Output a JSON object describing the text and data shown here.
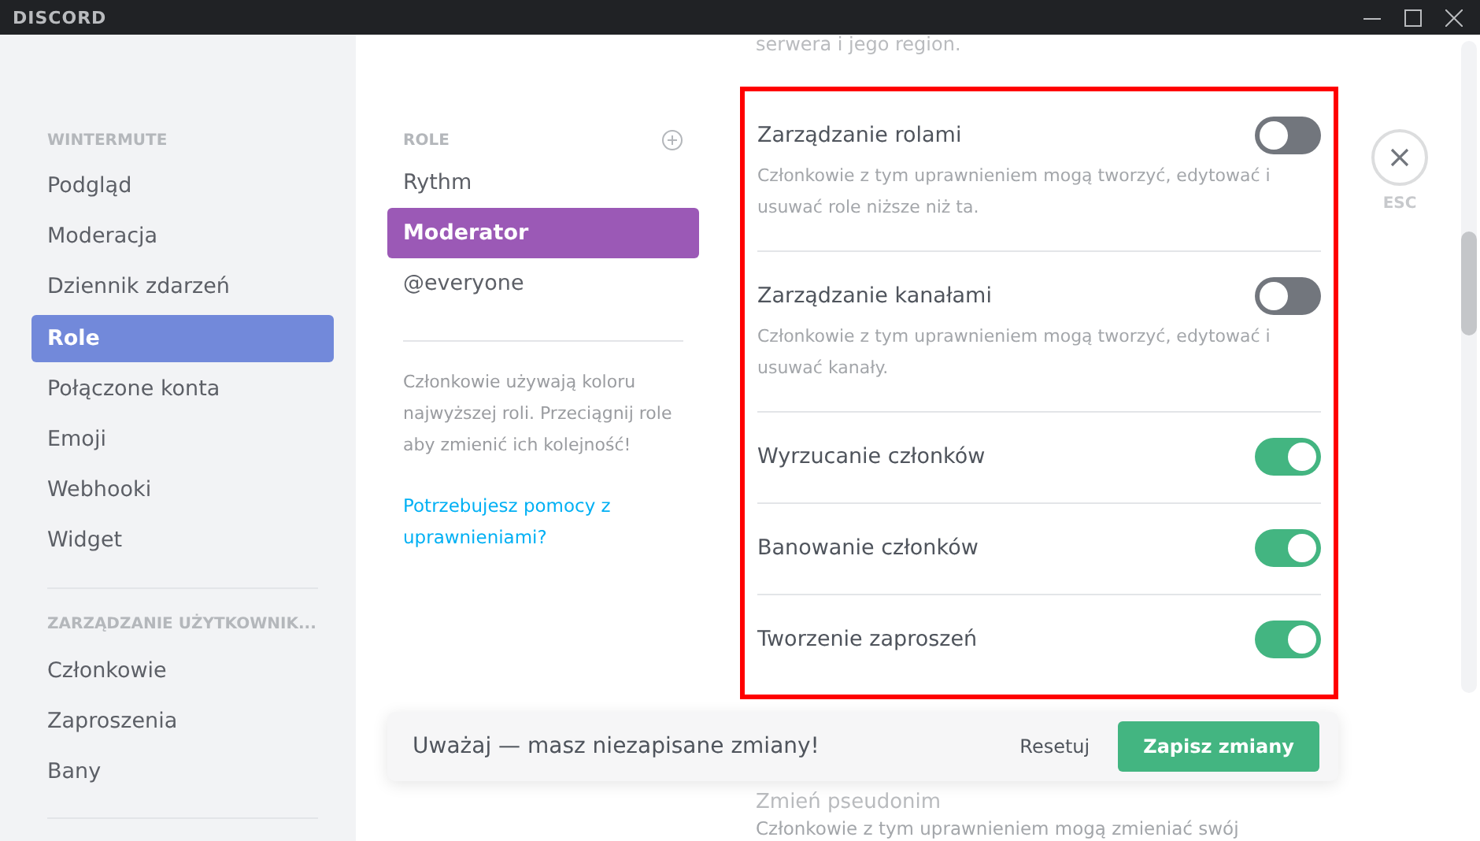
{
  "window": {
    "title": "DISCORD"
  },
  "sidebar": {
    "sections": [
      {
        "header": "WINTERMUTE",
        "items": [
          {
            "label": "Podgląd",
            "selected": false
          },
          {
            "label": "Moderacja",
            "selected": false
          },
          {
            "label": "Dziennik zdarzeń",
            "selected": false
          },
          {
            "label": "Role",
            "selected": true
          },
          {
            "label": "Połączone konta",
            "selected": false
          },
          {
            "label": "Emoji",
            "selected": false
          },
          {
            "label": "Webhooki",
            "selected": false
          },
          {
            "label": "Widget",
            "selected": false
          }
        ]
      },
      {
        "header": "ZARZĄDZANIE UŻYTKOWNIK...",
        "items": [
          {
            "label": "Członkowie",
            "selected": false
          },
          {
            "label": "Zaproszenia",
            "selected": false
          },
          {
            "label": "Bany",
            "selected": false
          }
        ]
      }
    ]
  },
  "roles": {
    "header": "ROLE",
    "items": [
      {
        "label": "Rythm",
        "selected": false
      },
      {
        "label": "Moderator",
        "selected": true
      },
      {
        "label": "@everyone",
        "selected": false
      }
    ],
    "hint": "Członkowie używają koloru najwyższej roli. Przeciągnij role aby zmienić ich kolejność!",
    "help_link": "Potrzebujesz pomocy z uprawnieniami?"
  },
  "permissions": {
    "top_text": "serwera i jego region.",
    "items": [
      {
        "title": "Zarządzanie rolami",
        "on": false,
        "description": "Członkowie z tym uprawnieniem mogą tworzyć, edytować i usuwać role niższe niż ta."
      },
      {
        "title": "Zarządzanie kanałami",
        "on": false,
        "description": "Członkowie z tym uprawnieniem mogą tworzyć, edytować i usuwać kanały."
      },
      {
        "title": "Wyrzucanie członków",
        "on": true
      },
      {
        "title": "Banowanie członków",
        "on": true
      },
      {
        "title": "Tworzenie zaproszeń",
        "on": true
      }
    ],
    "below": {
      "title": "Zmień pseudonim",
      "description": "Członkowie z tym uprawnieniem mogą zmieniać swój"
    }
  },
  "close": {
    "label": "ESC"
  },
  "notice": {
    "message": "Uważaj — masz niezapisane zmiany!",
    "reset": "Resetuj",
    "save": "Zapisz zmiany"
  }
}
